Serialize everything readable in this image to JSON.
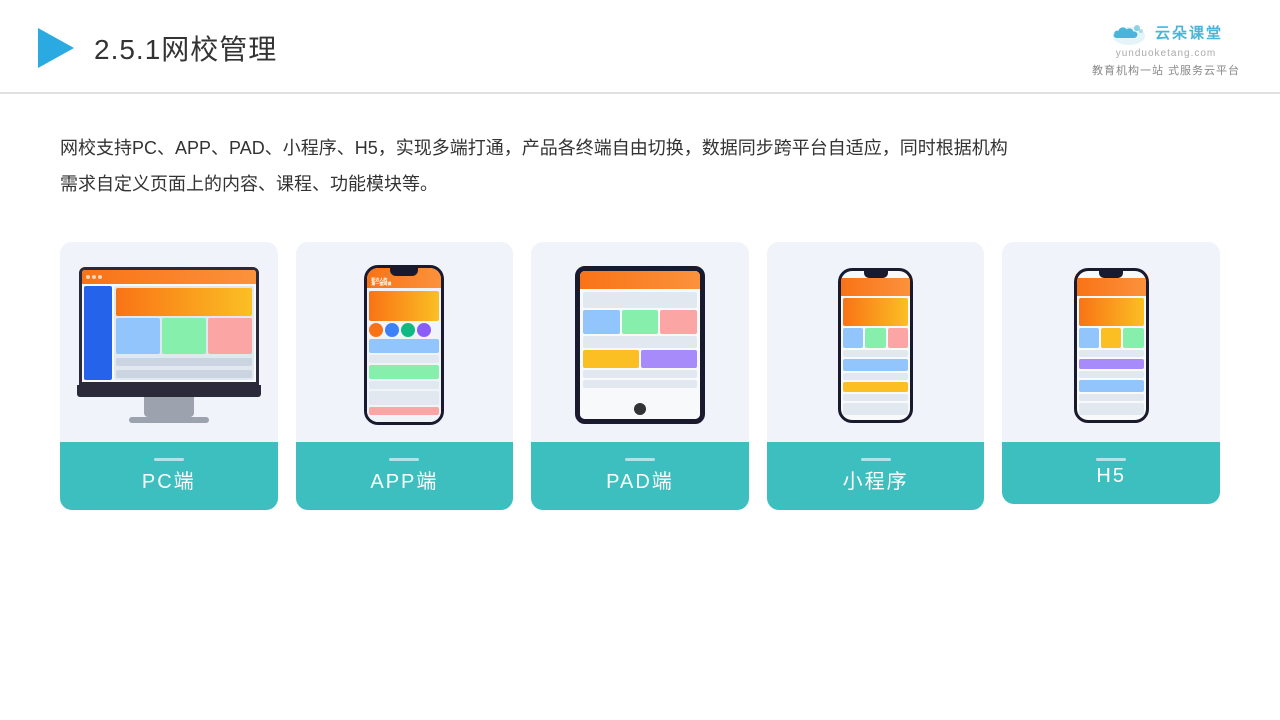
{
  "header": {
    "title_number": "2.5.1",
    "title_text": "网校管理",
    "logo_main": "云朵课堂",
    "logo_url": "yunduoketang.com",
    "logo_tagline1": "教育机构一站",
    "logo_tagline2": "式服务云平台"
  },
  "description": {
    "text": "网校支持PC、APP、PAD、小程序、H5，实现多端打通，产品各终端自由切换，数据同步跨平台自适应，同时根据机构",
    "text2": "需求自定义页面上的内容、课程、功能模块等。"
  },
  "cards": [
    {
      "id": "pc",
      "label": "PC端"
    },
    {
      "id": "app",
      "label": "APP端"
    },
    {
      "id": "pad",
      "label": "PAD端"
    },
    {
      "id": "mini",
      "label": "小程序"
    },
    {
      "id": "h5",
      "label": "H5"
    }
  ],
  "colors": {
    "accent": "#3dbfbf",
    "header_line": "#e0e0e0",
    "card_bg": "#f0f4fa"
  }
}
